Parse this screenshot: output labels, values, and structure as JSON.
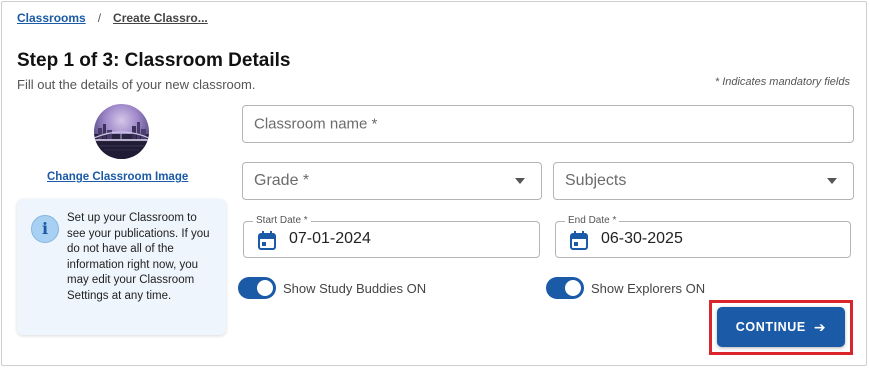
{
  "breadcrumb": {
    "root": "Classrooms",
    "separator": "/",
    "current": "Create Classro..."
  },
  "header": {
    "title": "Step 1 of 3: Classroom Details",
    "subtitle": "Fill out the details of your new classroom.",
    "mandatory_note": "* Indicates mandatory fields"
  },
  "image": {
    "change_label": "Change Classroom Image"
  },
  "info": {
    "icon": "info-icon",
    "text": "Set up your Classroom to see your publications. If you do not have all of the information right now, you may edit your Classroom Settings at any time."
  },
  "form": {
    "classroom_name": {
      "placeholder": "Classroom name *",
      "value": ""
    },
    "grade": {
      "placeholder": "Grade *",
      "value": ""
    },
    "subjects": {
      "placeholder": "Subjects",
      "value": ""
    },
    "start_date": {
      "label": "Start Date *",
      "value": "07-01-2024"
    },
    "end_date": {
      "label": "End Date *",
      "value": "06-30-2025"
    },
    "study_buddies": {
      "label": "Show Study Buddies ON",
      "checked": true
    },
    "explorers": {
      "label": "Show Explorers ON",
      "checked": true
    }
  },
  "actions": {
    "continue_label": "CONTINUE",
    "continue_icon": "arrow-right-icon"
  },
  "colors": {
    "accent": "#1a5aa6",
    "highlight": "#d9252b",
    "info_bg": "#eef5fc"
  }
}
